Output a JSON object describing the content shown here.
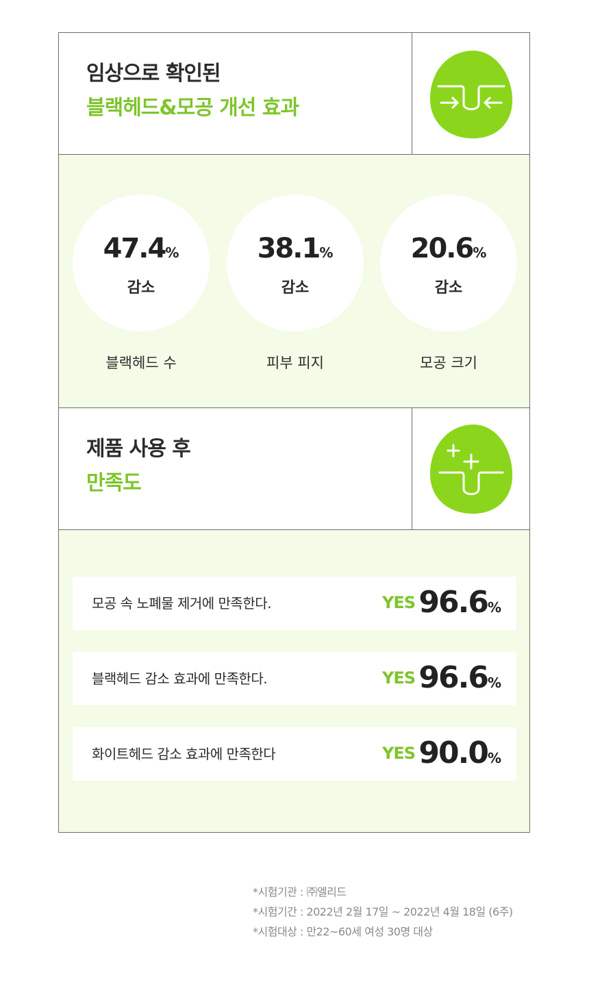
{
  "section1": {
    "title_line1": "임상으로 확인된",
    "title_line2": "블랙헤드&모공 개선 효과",
    "icon": "pore-shrink-icon"
  },
  "stats": [
    {
      "value": "47.4",
      "unit": "%",
      "change": "감소",
      "label": "블랙헤드 수"
    },
    {
      "value": "38.1",
      "unit": "%",
      "change": "감소",
      "label": "피부 피지"
    },
    {
      "value": "20.6",
      "unit": "%",
      "change": "감소",
      "label": "모공 크기"
    }
  ],
  "section2": {
    "title_line1": "제품 사용 후",
    "title_line2": "만족도",
    "icon": "pore-sparkle-icon"
  },
  "survey": [
    {
      "question": "모공 속 노폐물 제거에 만족한다.",
      "yes": "YES",
      "value": "96.6",
      "unit": "%"
    },
    {
      "question": "블랙헤드 감소 효과에 만족한다.",
      "yes": "YES",
      "value": "96.6",
      "unit": "%"
    },
    {
      "question": "화이트헤드 감소 효과에 만족한다",
      "yes": "YES",
      "value": "90.0",
      "unit": "%"
    }
  ],
  "notes": [
    "*시험기관 : ㈜엘리드",
    "*시험기간 : 2022년 2월 17일 ~ 2022년 4월 18일 (6주)",
    "*시험대상 : 만22~60세 여성 30명 대상"
  ],
  "colors": {
    "accent": "#7ec52b",
    "panel": "#f4fbe6",
    "border": "#6d6d6d",
    "icon": "#8bd61c"
  }
}
